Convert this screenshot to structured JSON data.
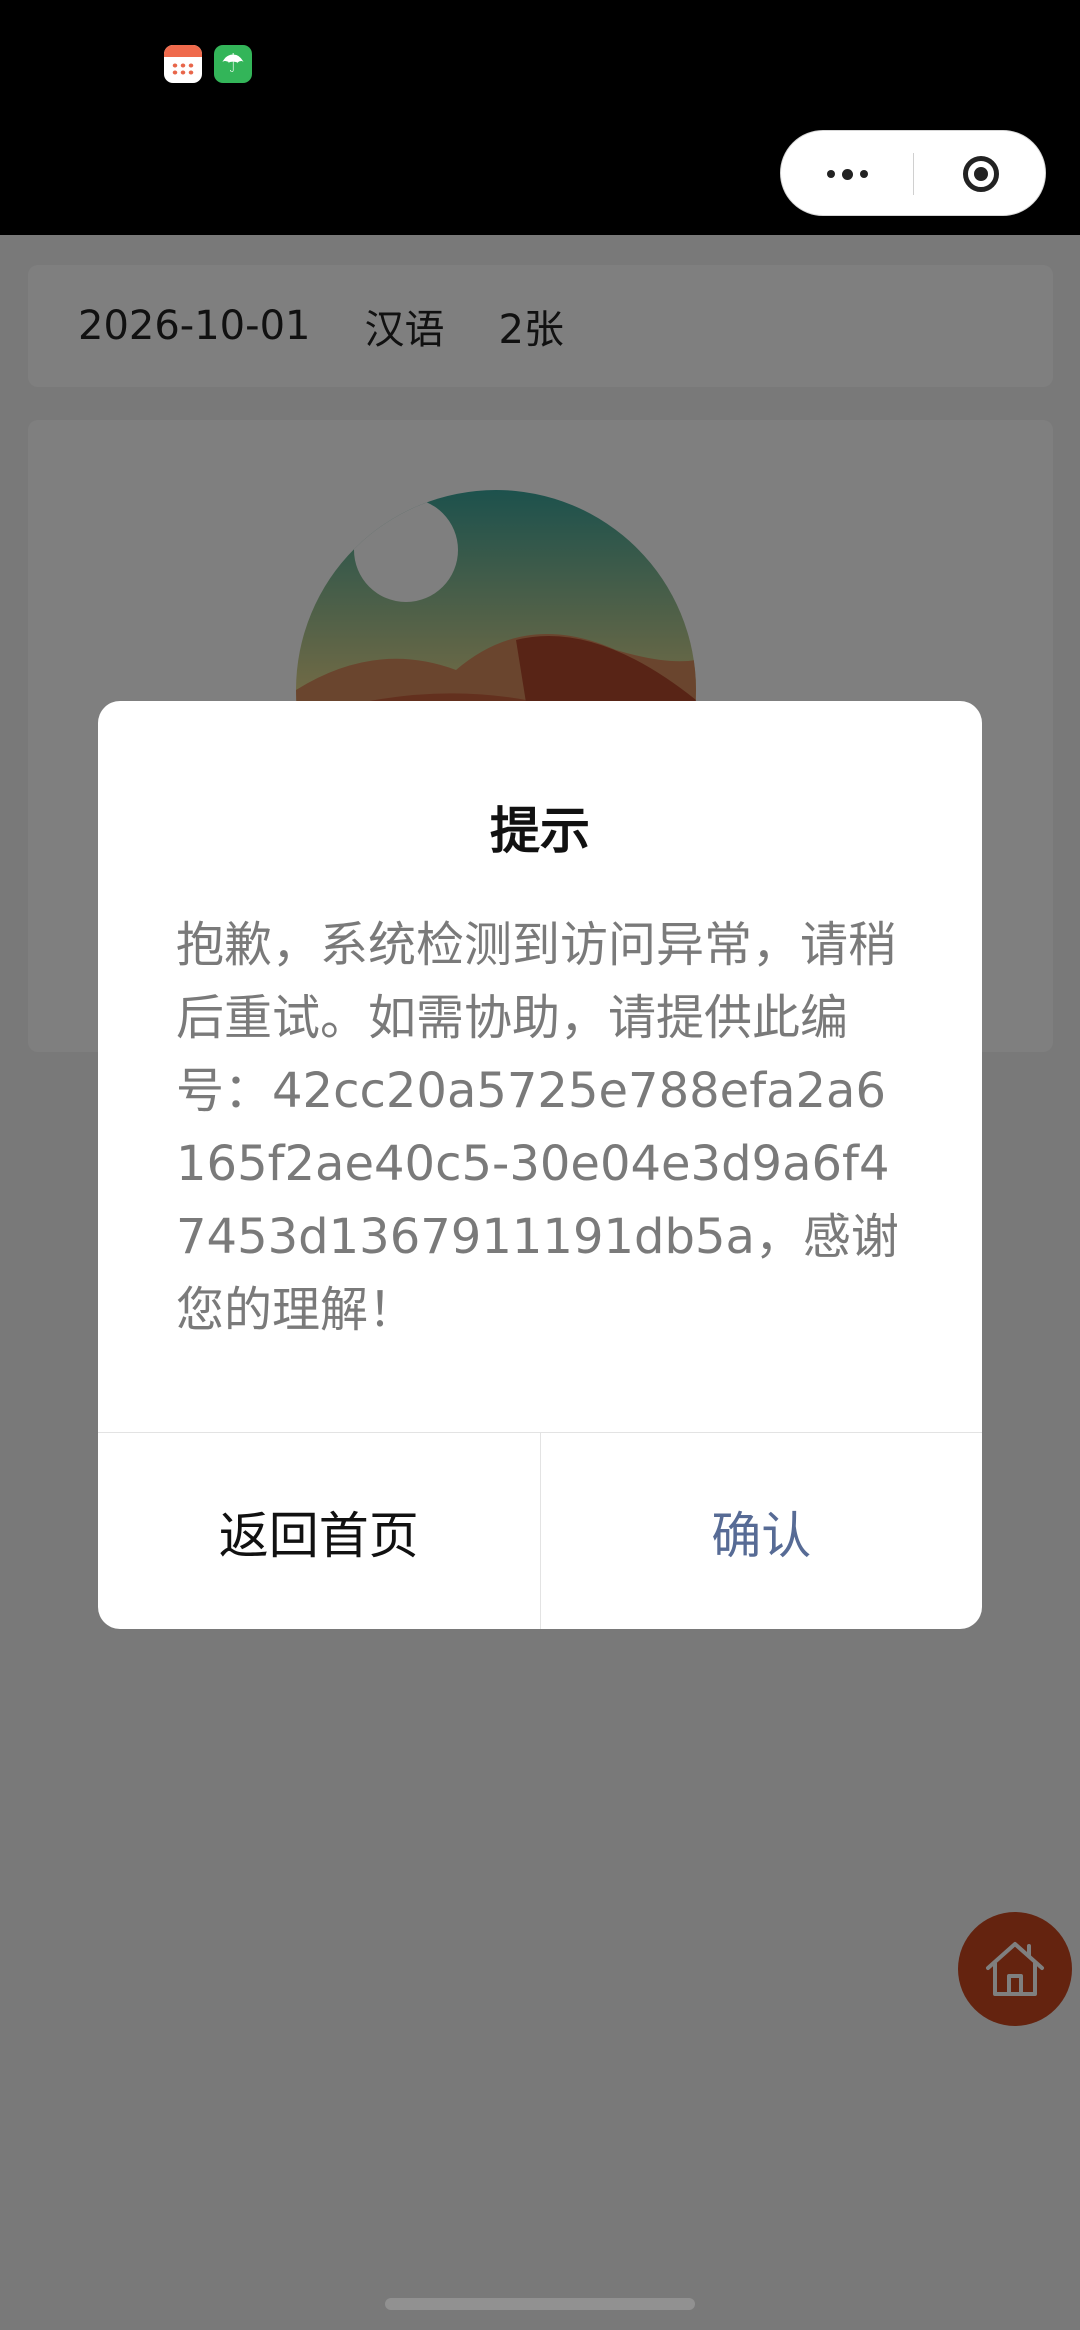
{
  "status_bar": {
    "icons": [
      "calendar-app-icon",
      "weather-umbrella-icon"
    ]
  },
  "capsule": {
    "icons": [
      "more-dots-icon",
      "close-target-icon"
    ]
  },
  "info": {
    "date": "2026-10-01",
    "language": "汉语",
    "count": "2张"
  },
  "dialog": {
    "title": "提示",
    "message": "抱歉，系统检测到访问异常，请稍后重试。如需协助，请提供此编号：42cc20a5725e788efa2a6165f2ae40c5-30e04e3d9a6f47453d1367911191db5a，感谢您的理解！",
    "back_label": "返回首页",
    "confirm_label": "确认"
  },
  "colors": {
    "confirm_text": "#576b95",
    "home_button": "#c8471f",
    "overlay": "rgba(0,0,0,0.5)"
  }
}
